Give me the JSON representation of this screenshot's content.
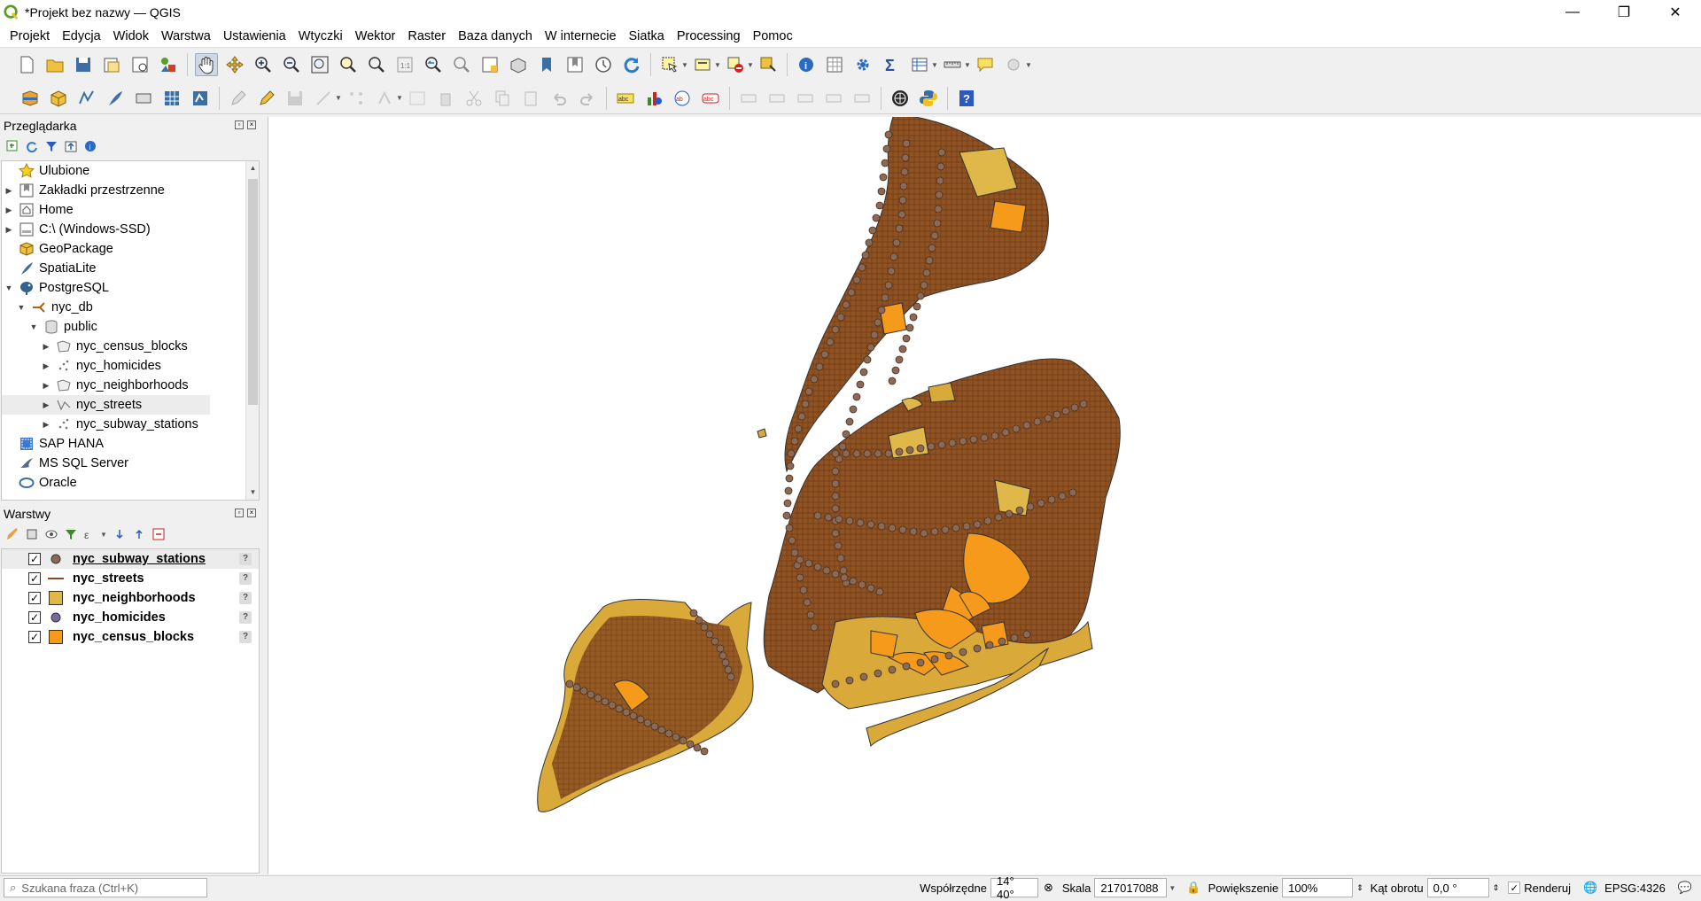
{
  "window": {
    "title": "*Projekt bez nazwy — QGIS",
    "minimize": "—",
    "restore": "❐",
    "close": "✕"
  },
  "menu": [
    "Projekt",
    "Edycja",
    "Widok",
    "Warstwa",
    "Ustawienia",
    "Wtyczki",
    "Wektor",
    "Raster",
    "Baza danych",
    "W internecie",
    "Siatka",
    "Processing",
    "Pomoc"
  ],
  "browser": {
    "title": "Przeglądarka",
    "items": [
      {
        "label": "Ulubione",
        "icon": "star-icon",
        "level": 0,
        "arrow": ""
      },
      {
        "label": "Zakładki przestrzenne",
        "icon": "bookmark-icon",
        "level": 0,
        "arrow": "▶"
      },
      {
        "label": "Home",
        "icon": "home-icon",
        "level": 0,
        "arrow": "▶"
      },
      {
        "label": "C:\\ (Windows-SSD)",
        "icon": "drive-icon",
        "level": 0,
        "arrow": "▶"
      },
      {
        "label": "GeoPackage",
        "icon": "geopackage-icon",
        "level": 0,
        "arrow": ""
      },
      {
        "label": "SpatiaLite",
        "icon": "spatialite-icon",
        "level": 0,
        "arrow": ""
      },
      {
        "label": "PostgreSQL",
        "icon": "postgresql-icon",
        "level": 0,
        "arrow": "▼"
      },
      {
        "label": "nyc_db",
        "icon": "connection-icon",
        "level": 1,
        "arrow": "▼"
      },
      {
        "label": "public",
        "icon": "schema-icon",
        "level": 2,
        "arrow": "▼"
      },
      {
        "label": "nyc_census_blocks",
        "icon": "polygon-layer-icon",
        "level": 3,
        "arrow": "▶"
      },
      {
        "label": "nyc_homicides",
        "icon": "point-layer-icon",
        "level": 3,
        "arrow": "▶"
      },
      {
        "label": "nyc_neighborhoods",
        "icon": "polygon-layer-icon",
        "level": 3,
        "arrow": "▶"
      },
      {
        "label": "nyc_streets",
        "icon": "line-layer-icon",
        "level": 3,
        "arrow": "▶"
      },
      {
        "label": "nyc_subway_stations",
        "icon": "point-layer-icon",
        "level": 3,
        "arrow": "▶"
      },
      {
        "label": "SAP HANA",
        "icon": "saphana-icon",
        "level": 0,
        "arrow": ""
      },
      {
        "label": "MS SQL Server",
        "icon": "mssql-icon",
        "level": 0,
        "arrow": ""
      },
      {
        "label": "Oracle",
        "icon": "oracle-icon",
        "level": 0,
        "arrow": ""
      }
    ]
  },
  "layers": {
    "title": "Warstwy",
    "items": [
      {
        "name": "nyc_subway_stations",
        "checked": "✓",
        "symbol": "point",
        "color": "#8b6a55"
      },
      {
        "name": "nyc_streets",
        "checked": "✓",
        "symbol": "line",
        "color": "#8b4a1e"
      },
      {
        "name": "nyc_neighborhoods",
        "checked": "✓",
        "symbol": "fill",
        "color": "#e0b84a"
      },
      {
        "name": "nyc_homicides",
        "checked": "✓",
        "symbol": "point",
        "color": "#7a6a9a"
      },
      {
        "name": "nyc_census_blocks",
        "checked": "✓",
        "symbol": "fill",
        "color": "#f59a1a"
      }
    ],
    "unknown_marker": "?"
  },
  "statusbar": {
    "search_placeholder": "Szukana fraza (Ctrl+K)",
    "coords_label": "Współrzędne",
    "coords_value": "14° 40°",
    "scale_label": "Skala",
    "scale_value": "217017088",
    "magnifier_label": "Powiększenie",
    "magnifier_value": "100%",
    "rotation_label": "Kąt obrotu",
    "rotation_value": "0,0 °",
    "render_label": "Renderuj",
    "crs_value": "EPSG:4326"
  },
  "colors": {
    "census_fill": "#f59a1a",
    "neighborhood_fill": "#e0b84a",
    "street_dense": "#8b4a1e",
    "station": "#8b6a55"
  }
}
